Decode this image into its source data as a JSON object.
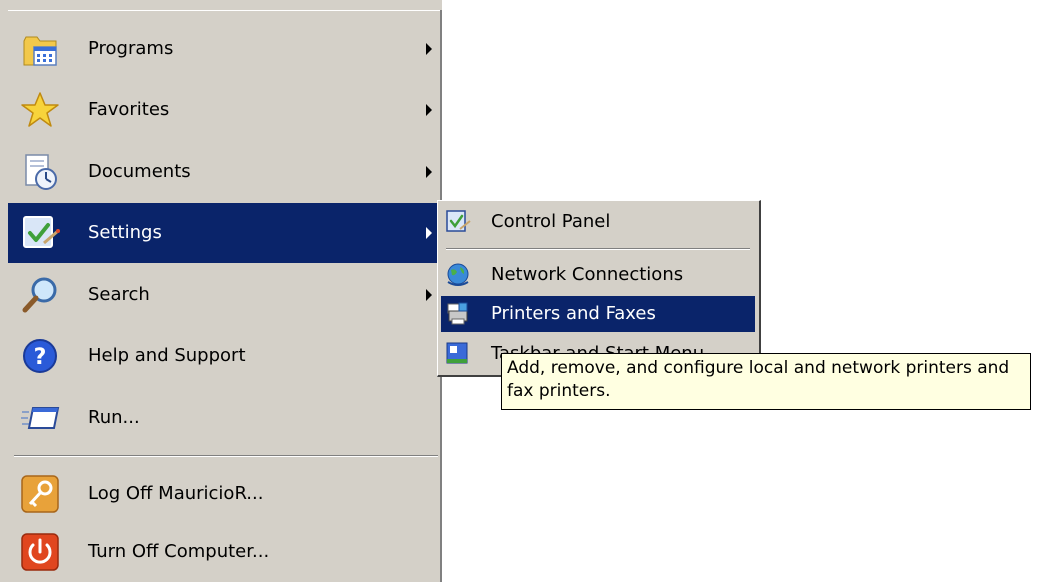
{
  "start_menu": {
    "items": [
      {
        "label": "Programs",
        "icon": "programs-icon",
        "has_submenu": true
      },
      {
        "label": "Favorites",
        "icon": "star-icon",
        "has_submenu": true
      },
      {
        "label": "Documents",
        "icon": "documents-icon",
        "has_submenu": true
      },
      {
        "label": "Settings",
        "icon": "settings-icon",
        "has_submenu": true,
        "highlighted": true
      },
      {
        "label": "Search",
        "icon": "magnifier-icon",
        "has_submenu": true
      },
      {
        "label": "Help and Support",
        "icon": "help-icon",
        "has_submenu": false
      },
      {
        "label": "Run...",
        "icon": "run-icon",
        "has_submenu": false
      },
      {
        "label": "Log Off MauricioR...",
        "icon": "key-icon",
        "has_submenu": false
      },
      {
        "label": "Turn Off Computer...",
        "icon": "power-icon",
        "has_submenu": false
      }
    ]
  },
  "settings_submenu": {
    "items": [
      {
        "label": "Control Panel",
        "icon": "control-panel-icon"
      },
      {
        "label": "Network Connections",
        "icon": "network-icon"
      },
      {
        "label": "Printers and Faxes",
        "icon": "printer-icon",
        "highlighted": true
      },
      {
        "label": "Taskbar and Start Menu",
        "icon": "taskbar-icon"
      }
    ]
  },
  "tooltip": {
    "text": "Add, remove, and configure local and network printers and fax printers."
  },
  "colors": {
    "menu_background": "#d4d0c8",
    "highlight": "#0a246a",
    "tooltip_background": "#ffffe1"
  }
}
